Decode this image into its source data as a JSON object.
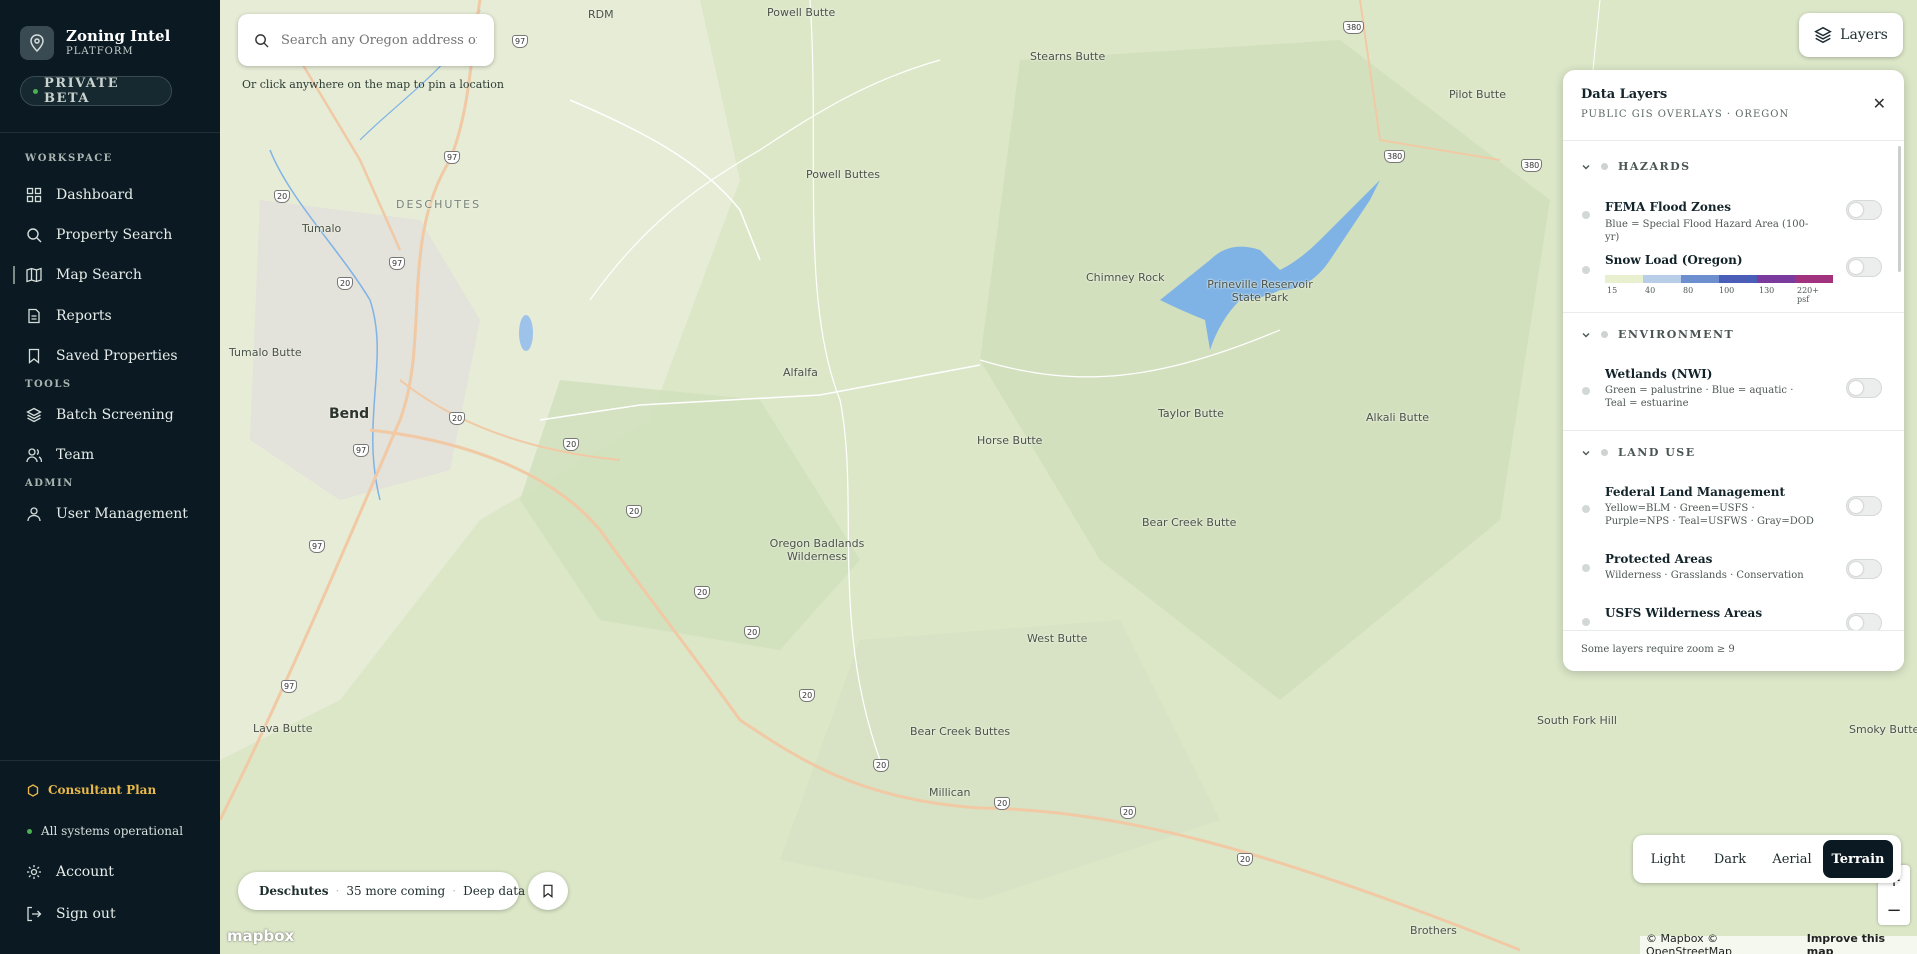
{
  "brand": {
    "name": "Zoning Intel",
    "sub": "PLATFORM",
    "badge": "PRIVATE BETA"
  },
  "sidebar": {
    "workspace_label": "WORKSPACE",
    "tools_label": "TOOLS",
    "admin_label": "ADMIN",
    "items": [
      {
        "label": "Dashboard",
        "icon": "dashboard-icon"
      },
      {
        "label": "Property Search",
        "icon": "search-icon"
      },
      {
        "label": "Map Search",
        "icon": "map-icon",
        "active": true
      },
      {
        "label": "Reports",
        "icon": "report-icon"
      },
      {
        "label": "Saved Properties",
        "icon": "bookmark-icon"
      },
      {
        "label": "Batch Screening",
        "icon": "layers-icon"
      },
      {
        "label": "Team",
        "icon": "team-icon"
      },
      {
        "label": "User Management",
        "icon": "user-icon"
      }
    ],
    "plan": "Consultant Plan",
    "status": "All systems operational",
    "account": "Account",
    "signout": "Sign out"
  },
  "search": {
    "placeholder": "Search any Oregon address or parcel",
    "hint": "Or click anywhere on the map to pin a location"
  },
  "layers_button": "Layers",
  "panel": {
    "title": "Data Layers",
    "subtitle": "PUBLIC GIS OVERLAYS · OREGON",
    "groups": [
      {
        "label": "HAZARDS"
      },
      {
        "label": "ENVIRONMENT"
      },
      {
        "label": "LAND USE"
      }
    ],
    "layers": [
      {
        "name": "FEMA Flood Zones",
        "desc": "Blue = Special Flood Hazard Area (100-yr)"
      },
      {
        "name": "Snow Load (Oregon)",
        "desc": ""
      },
      {
        "name": "Wetlands (NWI)",
        "desc": "Green = palustrine · Blue = aquatic · Teal = estuarine"
      },
      {
        "name": "Federal Land Management",
        "desc": "Yellow=BLM · Green=USFS · Purple=NPS · Teal=USFWS · Gray=DOD"
      },
      {
        "name": "Protected Areas",
        "desc": "Wilderness · Grasslands · Conservation"
      },
      {
        "name": "USFS Wilderness Areas",
        "desc": ""
      }
    ],
    "snow_scale": {
      "labels": [
        "15",
        "40",
        "80",
        "100",
        "130",
        "220+ psf"
      ],
      "colors": [
        "#e8f0cf",
        "#b7cde8",
        "#6d8fd0",
        "#4a5eb8",
        "#7a3a9e",
        "#a0327e"
      ]
    },
    "footer": "Some layers require zoom ≥ 9"
  },
  "chip": {
    "county": "Deschutes",
    "more": "35 more coming",
    "deep": "Deep data"
  },
  "map_styles": [
    {
      "label": "Light"
    },
    {
      "label": "Dark"
    },
    {
      "label": "Aerial"
    },
    {
      "label": "Terrain",
      "active": true
    }
  ],
  "zoom": {
    "in": "+",
    "out": "−"
  },
  "attribution": {
    "text": "© Mapbox © OpenStreetMap",
    "improve": "Improve this map",
    "logo": "mapbox"
  },
  "places": [
    {
      "name": "Bend",
      "cls": "big"
    },
    {
      "name": "DESCHUTES",
      "cls": "region"
    },
    {
      "name": "Tumalo"
    },
    {
      "name": "Tumalo Butte"
    },
    {
      "name": "Powell Butte"
    },
    {
      "name": "Powell Buttes"
    },
    {
      "name": "Alfalfa"
    },
    {
      "name": "Horse Butte"
    },
    {
      "name": "Oregon Badlands Wilderness"
    },
    {
      "name": "Chimney Rock"
    },
    {
      "name": "Prineville Reservoir State Park"
    },
    {
      "name": "Stearns Butte"
    },
    {
      "name": "Pilot Butte"
    },
    {
      "name": "Taylor Butte"
    },
    {
      "name": "Alkali Butte"
    },
    {
      "name": "Bear Creek Butte"
    },
    {
      "name": "West Butte"
    },
    {
      "name": "Bear Creek Buttes"
    },
    {
      "name": "Lava Butte"
    },
    {
      "name": "Millican"
    },
    {
      "name": "South Fork Hill"
    },
    {
      "name": "Smoky Butte"
    },
    {
      "name": "Brothers"
    },
    {
      "name": "RDM"
    }
  ],
  "shields": [
    "97",
    "97",
    "97",
    "97",
    "97",
    "97",
    "20",
    "20",
    "20",
    "20",
    "20",
    "20",
    "20",
    "20",
    "20",
    "20",
    "20",
    "20",
    "380",
    "380",
    "380"
  ]
}
